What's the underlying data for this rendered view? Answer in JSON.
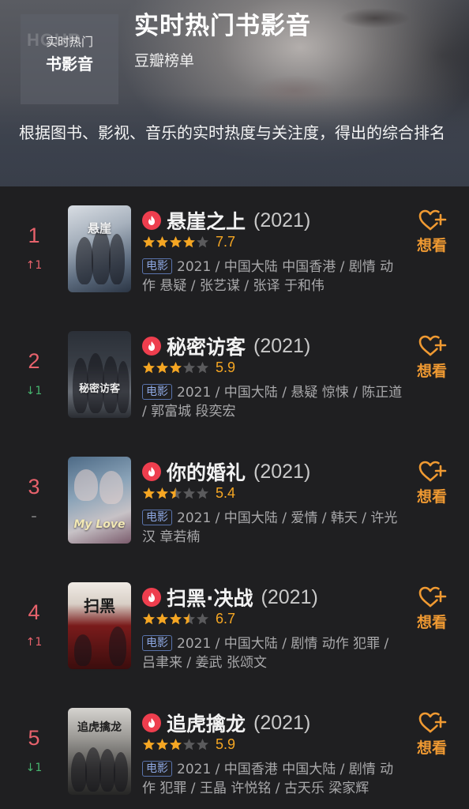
{
  "header": {
    "badge_watermark": "HOUR",
    "badge_sub": "实时热门",
    "badge_main": "书影音",
    "title": "实时热门书影音",
    "subtitle": "豆瓣榜单",
    "description": "根据图书、影视、音乐的实时热度与关注度，得出的综合排名"
  },
  "colors": {
    "rank": "#e7626c",
    "up": "#e7626c",
    "down": "#46b46e",
    "star": "#f5a623",
    "want": "#f09a32",
    "hot_icon": "#ee3e4e",
    "tag": "#8ea8e2"
  },
  "items": [
    {
      "rank": "1",
      "change": "↑1",
      "change_dir": "up",
      "title": "悬崖之上",
      "year": "(2021)",
      "stars_filled": 4,
      "stars_half": 0,
      "score": "7.7",
      "tag": "电影",
      "meta": "2021 / 中国大陆 中国香港 / 剧情 动作 悬疑 / 张艺谋 / 张译 于和伟",
      "poster_text": "悬崖",
      "want_label": "想看"
    },
    {
      "rank": "2",
      "change": "↓1",
      "change_dir": "down",
      "title": "秘密访客",
      "year": "(2021)",
      "stars_filled": 3,
      "stars_half": 0,
      "score": "5.9",
      "tag": "电影",
      "meta": "2021 / 中国大陆 / 悬疑 惊悚 / 陈正道 / 郭富城 段奕宏",
      "poster_text": "秘密访客",
      "want_label": "想看"
    },
    {
      "rank": "3",
      "change": "–",
      "change_dir": "same",
      "title": "你的婚礼",
      "year": "(2021)",
      "stars_filled": 2,
      "stars_half": 1,
      "score": "5.4",
      "tag": "电影",
      "meta": "2021 / 中国大陆 / 爱情 / 韩天 / 许光汉 章若楠",
      "poster_text": "My Love",
      "want_label": "想看"
    },
    {
      "rank": "4",
      "change": "↑1",
      "change_dir": "up",
      "title": "扫黑·决战",
      "year": "(2021)",
      "stars_filled": 3,
      "stars_half": 1,
      "score": "6.7",
      "tag": "电影",
      "meta": "2021 / 中国大陆 / 剧情 动作 犯罪 / 吕聿来 / 姜武 张颂文",
      "poster_text": "扫黑",
      "want_label": "想看"
    },
    {
      "rank": "5",
      "change": "↓1",
      "change_dir": "down",
      "title": "追虎擒龙",
      "year": "(2021)",
      "stars_filled": 3,
      "stars_half": 0,
      "score": "5.9",
      "tag": "电影",
      "meta": "2021 / 中国香港 中国大陆 / 剧情 动作 犯罪 / 王晶 许悦铭 / 古天乐 梁家辉",
      "poster_text": "追虎擒龙",
      "want_label": "想看"
    }
  ]
}
